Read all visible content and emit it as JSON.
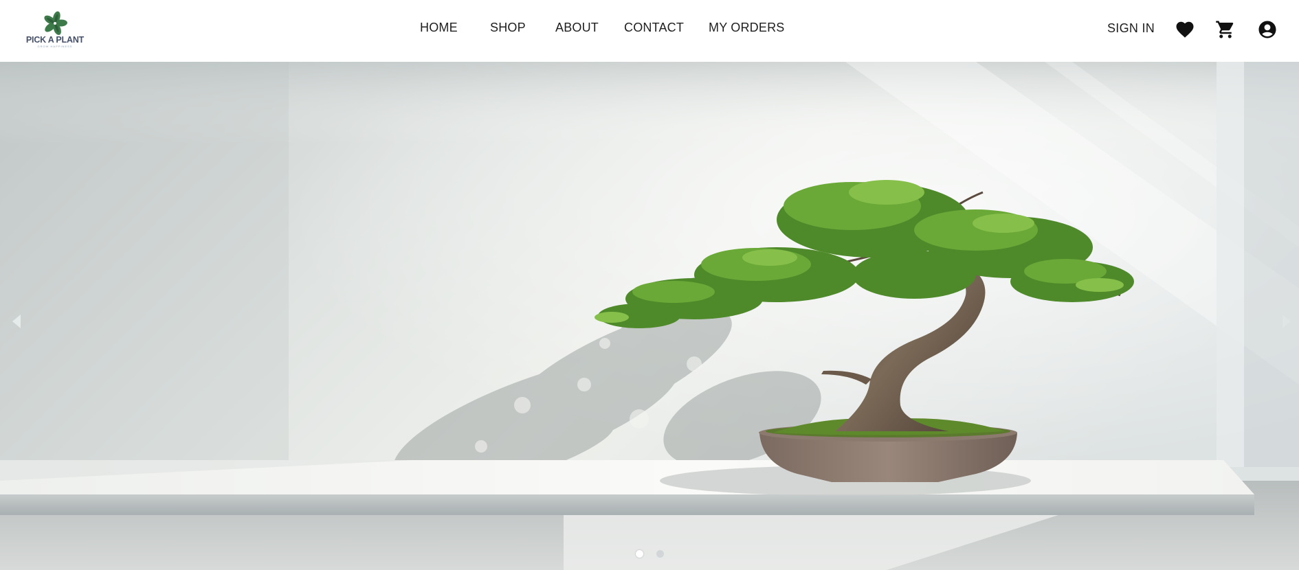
{
  "brand": {
    "name": "PICK A PLANT",
    "tagline": "GROW HAPPINESS",
    "logo_color": "#3d7a4a"
  },
  "nav": {
    "items": [
      {
        "label": "HOME"
      },
      {
        "label": "SHOP"
      },
      {
        "label": "ABOUT"
      },
      {
        "label": "CONTACT"
      },
      {
        "label": "MY ORDERS"
      }
    ]
  },
  "header_actions": {
    "signin_label": "SIGN IN",
    "icons": [
      "heart-icon",
      "cart-icon",
      "account-icon"
    ]
  },
  "hero": {
    "image_subject": "bonsai-tree",
    "slide_count": 2,
    "active_slide": 1
  }
}
